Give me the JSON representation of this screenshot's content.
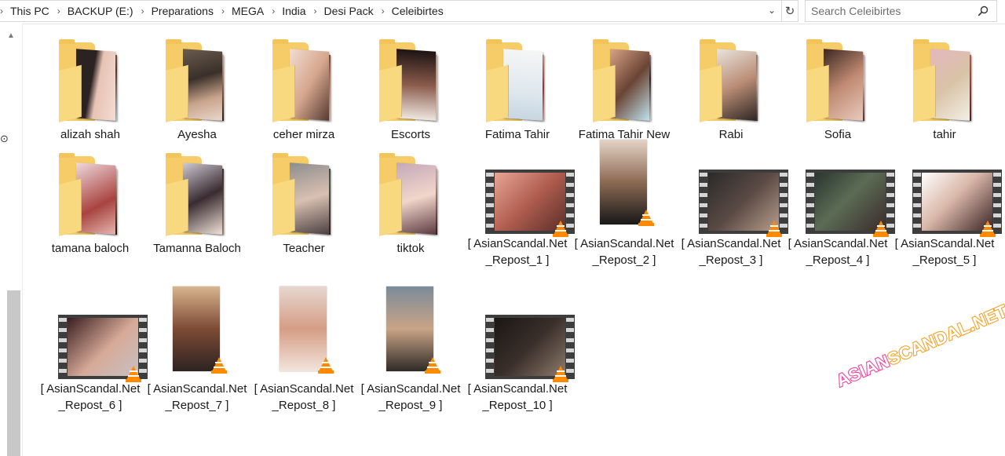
{
  "breadcrumb": [
    "This PC",
    "BACKUP (E:)",
    "Preparations",
    "MEGA",
    "India",
    "Desi Pack",
    "Celeibirtes"
  ],
  "search": {
    "placeholder": "Search Celeibirtes"
  },
  "icons": {
    "address_dropdown": "chevron-down-icon",
    "refresh": "refresh-icon",
    "search": "search-icon"
  },
  "items": [
    {
      "name": "alizah shah",
      "kind": "folder"
    },
    {
      "name": "Ayesha",
      "kind": "folder"
    },
    {
      "name": "ceher mirza",
      "kind": "folder"
    },
    {
      "name": "Escorts",
      "kind": "folder"
    },
    {
      "name": "Fatima Tahir",
      "kind": "folder"
    },
    {
      "name": "Fatima Tahir New",
      "kind": "folder"
    },
    {
      "name": "Rabi",
      "kind": "folder"
    },
    {
      "name": "Sofia",
      "kind": "folder"
    },
    {
      "name": "tahir",
      "kind": "folder"
    },
    {
      "name": "tamana baloch",
      "kind": "folder"
    },
    {
      "name": "Tamanna Baloch",
      "kind": "folder"
    },
    {
      "name": "Teacher",
      "kind": "folder"
    },
    {
      "name": "tiktok",
      "kind": "folder"
    },
    {
      "name": "[ AsianScandal.Net _Repost_1 ]",
      "kind": "video-wide"
    },
    {
      "name": "[ AsianScandal.Net _Repost_2 ]",
      "kind": "video-portrait"
    },
    {
      "name": "[ AsianScandal.Net _Repost_3 ]",
      "kind": "video-wide"
    },
    {
      "name": "[ AsianScandal.Net _Repost_4 ]",
      "kind": "video-wide"
    },
    {
      "name": "[ AsianScandal.Net _Repost_5 ]",
      "kind": "video-wide"
    },
    {
      "name": "[ AsianScandal.Net _Repost_6 ]",
      "kind": "video-wide"
    },
    {
      "name": "[ AsianScandal.Net _Repost_7 ]",
      "kind": "video-portrait"
    },
    {
      "name": "[ AsianScandal.Net _Repost_8 ]",
      "kind": "video-portrait"
    },
    {
      "name": "[ AsianScandal.Net _Repost_9 ]",
      "kind": "video-portrait"
    },
    {
      "name": "[ AsianScandal.Net _Repost_10 ]",
      "kind": "video-wide"
    }
  ],
  "watermark": {
    "part1": "ASIAN",
    "part2": "SCANDAL.NET"
  },
  "colors": {
    "folder": "#f6cc68",
    "vlc_cone": "#ff8a00",
    "watermark_pink": "#e8409b",
    "watermark_orange": "#f0a020"
  }
}
